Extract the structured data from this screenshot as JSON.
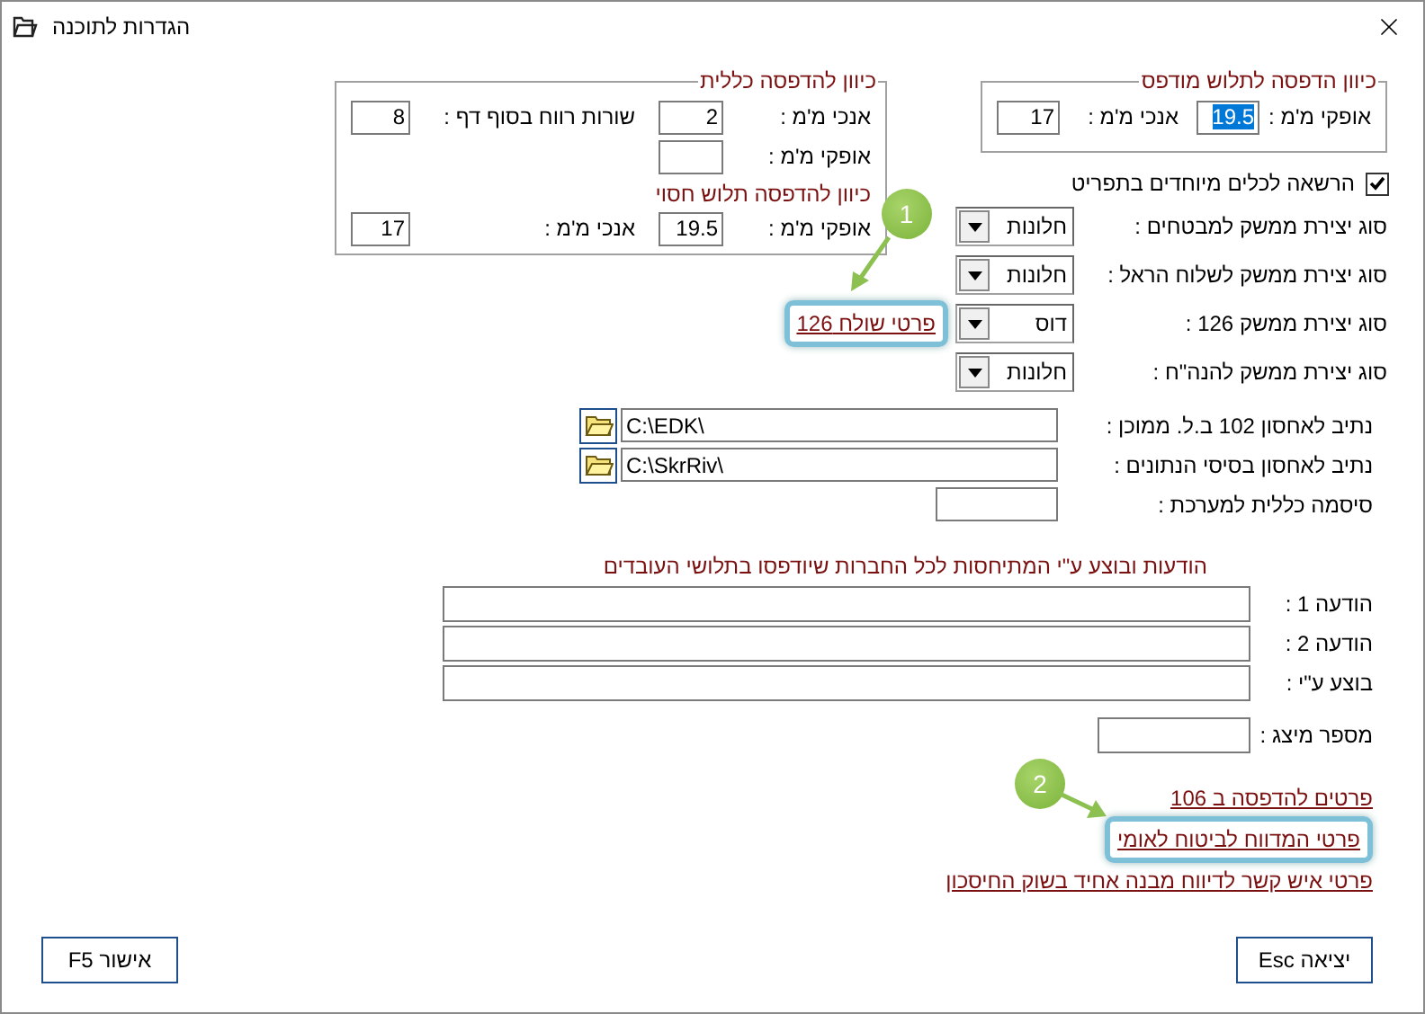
{
  "window": {
    "title": "הגדרות לתוכנה"
  },
  "general_group": {
    "legend": "כיוון להדפסה כללית",
    "items": [
      {
        "kind": "fields",
        "fields": [
          {
            "label": "אנכי מ'מ :",
            "value": "2"
          },
          {
            "label": "שורות רווח בסוף דף :",
            "value": "8"
          }
        ]
      },
      {
        "kind": "fields",
        "fields": [
          {
            "label": "אופקי מ'מ :"
          }
        ]
      },
      {
        "kind": "subtitle",
        "text": "כיוון להדפסה תלוש חסוי"
      },
      {
        "kind": "fields",
        "fields": [
          {
            "label": "אופקי מ'מ :",
            "value": "19.5"
          },
          {
            "label": "אנכי מ'מ :",
            "value": "17"
          }
        ]
      }
    ]
  },
  "printed_group": {
    "legend": "כיוון הדפסה לתלוש מודפס",
    "fields": [
      {
        "label": "אופקי מ'מ :",
        "value": "19.5",
        "selected": true
      },
      {
        "label": "אנכי מ'מ :",
        "value": "17",
        "selected": false
      }
    ]
  },
  "special_tools": {
    "label": "הרשאה לכלים מיוחדים בתפריט",
    "checked": true
  },
  "interface_rows": [
    {
      "label": "סוג יצירת ממשק למבטחים :",
      "value": "חלונות"
    },
    {
      "label": "סוג יצירת ממשק לשלוח הראל :",
      "value": "חלונות"
    },
    {
      "label": "סוג יצירת ממשק 126 :",
      "value": "דוס",
      "link": {
        "text": "פרטי שולח 126",
        "highlighted": true,
        "callout": "1"
      }
    },
    {
      "label": "סוג יצירת ממשק להנה\"ח :",
      "value": "חלונות"
    }
  ],
  "paths": [
    {
      "label": "נתיב לאחסון 102 ב.ל. ממוכן :",
      "value": "C:\\EDK\\"
    },
    {
      "label": "נתיב לאחסון בסיסי הנתונים :",
      "value": "C:\\SkrRiv\\"
    }
  ],
  "password": {
    "label": "סיסמה כללית למערכת :"
  },
  "messages": {
    "title": "הודעות ובוצע ע\"י המתיחסות לכל החברות שיודפסו בתלושי העובדים",
    "fields": [
      {
        "label": "הודעה 1 :"
      },
      {
        "label": "הודעה 2 :"
      },
      {
        "label": "בוצע ע\"י :"
      }
    ]
  },
  "presenter": {
    "label": "מספר מיצג :"
  },
  "links": [
    {
      "text": "פרטים להדפסה ב 106",
      "highlighted": false
    },
    {
      "text": "פרטי המדווח לביטוח לאומי",
      "highlighted": true,
      "callout": "2"
    },
    {
      "text": "פרטי איש קשר לדיווח מבנה אחיד בשוק החיסכון",
      "highlighted": false
    }
  ],
  "buttons": [
    {
      "kind": "exit",
      "label": "יציאה Esc"
    },
    {
      "kind": "ok",
      "label": "אישור F5"
    }
  ]
}
